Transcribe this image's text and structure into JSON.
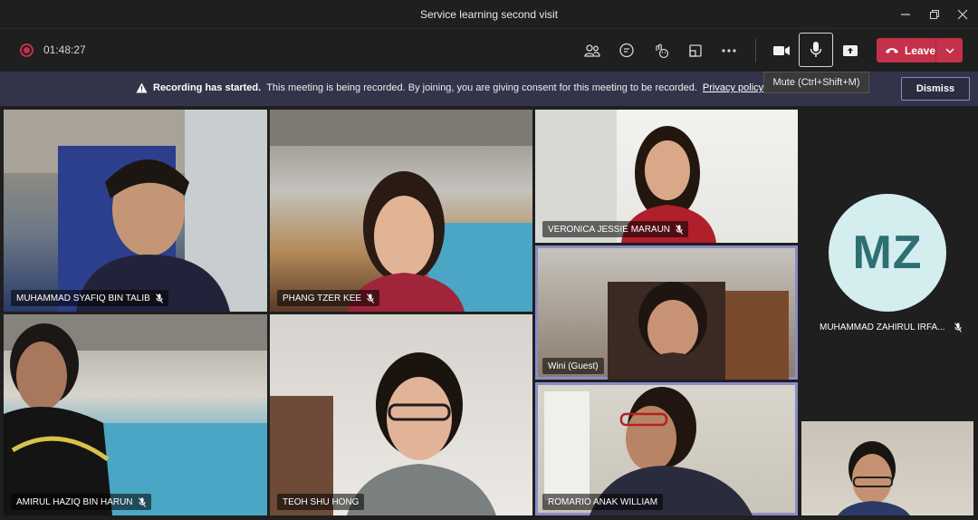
{
  "window": {
    "title": "Service learning second visit"
  },
  "toolbar": {
    "timer": "01:48:27",
    "icons": [
      "people-icon",
      "chat-icon",
      "reactions-icon",
      "rooms-icon",
      "more-icon",
      "camera-icon",
      "mic-icon",
      "share-icon"
    ],
    "leave_label": "Leave",
    "mute_tooltip": "Mute (Ctrl+Shift+M)"
  },
  "banner": {
    "title": "Recording has started.",
    "message": "This meeting is being recorded. By joining, you are giving consent for this meeting to be recorded.",
    "link": "Privacy policy",
    "dismiss_label": "Dismiss"
  },
  "participants": [
    {
      "name": "MUHAMMAD SYAFIQ BIN TALIB",
      "muted": true
    },
    {
      "name": "PHANG TZER KEE",
      "muted": true
    },
    {
      "name": "VERONICA JESSIE MARAUN",
      "muted": true
    },
    {
      "name": "Wini (Guest)",
      "muted": false
    },
    {
      "name": "AMIRUL HAZIQ BIN HARUN",
      "muted": true
    },
    {
      "name": "TEOH SHU HONG",
      "muted": false
    },
    {
      "name": "ROMARIO ANAK WILLIAM",
      "muted": false
    }
  ],
  "side_participant": {
    "initials": "MZ",
    "name": "MUHAMMAD ZAHIRUL IRFA...",
    "muted": true
  },
  "colors": {
    "leave": "#c4314b",
    "banner": "#33344a",
    "highlight": "#8b8cc7",
    "avatar_bg": "#d4eef0",
    "avatar_fg": "#2e6f73"
  }
}
